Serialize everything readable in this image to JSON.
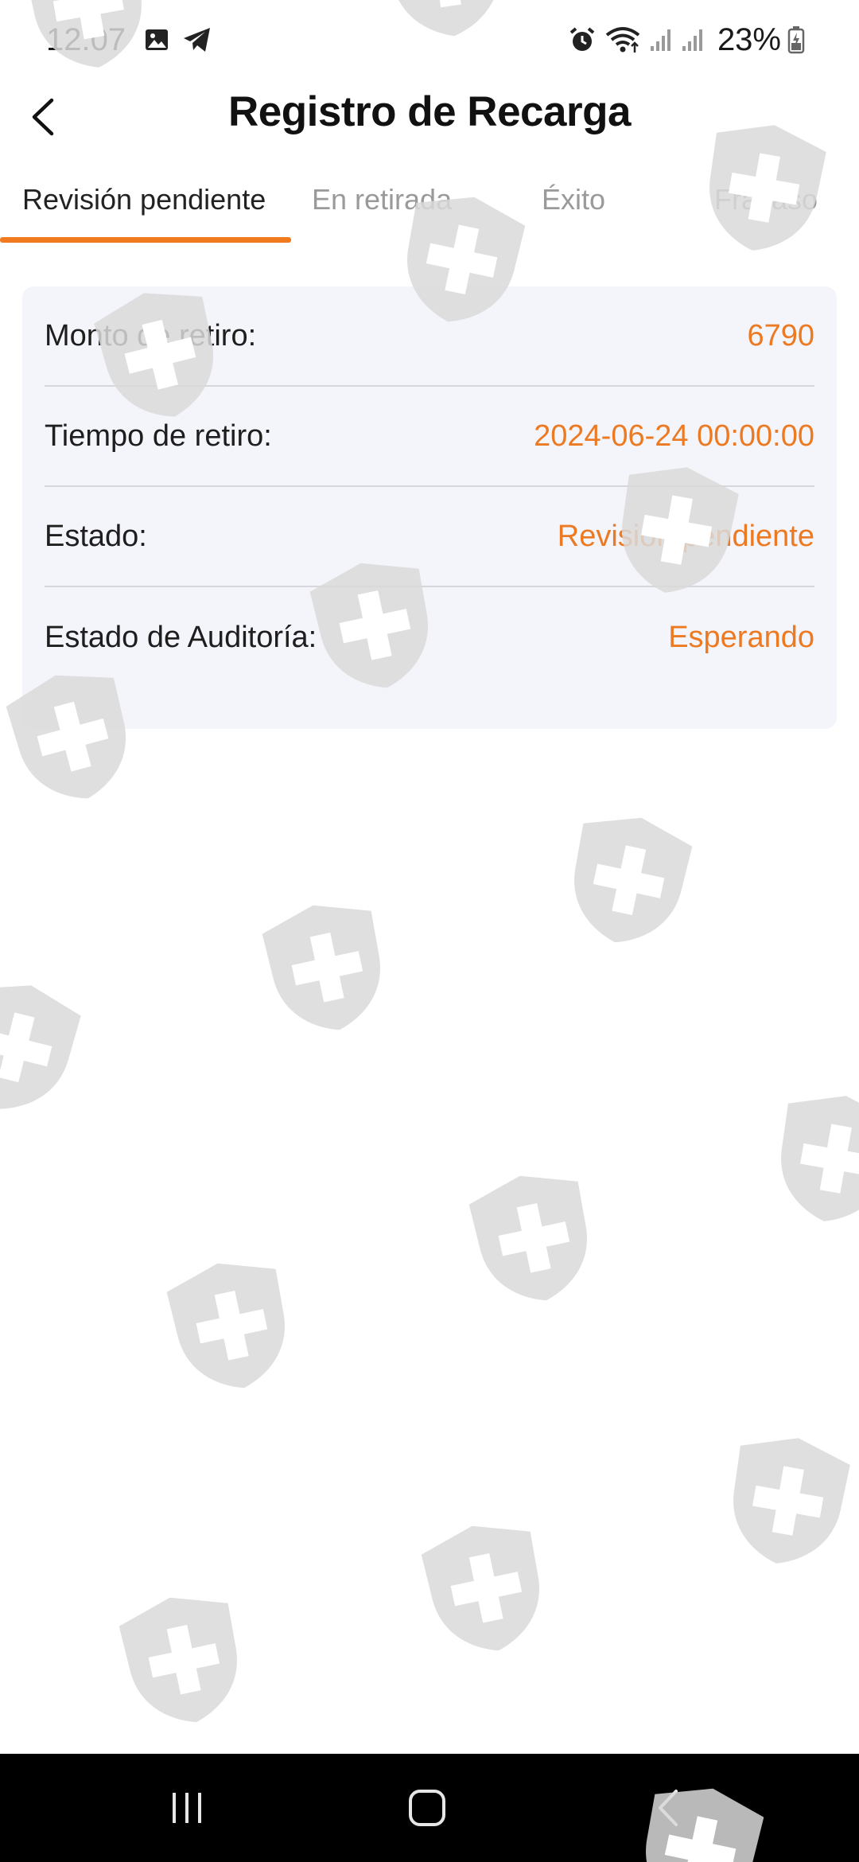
{
  "status_bar": {
    "time": "12:07",
    "battery_percent": "23%",
    "left_icons": [
      "gallery-icon",
      "telegram-icon"
    ],
    "right_icons": [
      "alarm-icon",
      "wifi-icon",
      "signal-icon",
      "signal-icon",
      "battery-icon"
    ]
  },
  "header": {
    "title": "Registro de Recarga",
    "back_icon": "chevron-left-icon"
  },
  "tabs": [
    {
      "label": "Revisión pendiente",
      "active": true
    },
    {
      "label": "En retirada",
      "active": false
    },
    {
      "label": "Éxito",
      "active": false
    },
    {
      "label": "Fracaso",
      "active": false
    }
  ],
  "record": {
    "rows": [
      {
        "label": "Monto de retiro:",
        "value": "6790"
      },
      {
        "label": "Tiempo de retiro:",
        "value": "2024-06-24 00:00:00"
      },
      {
        "label": "Estado:",
        "value": "Revisión pendiente"
      },
      {
        "label": "Estado de Auditoría:",
        "value": "Esperando"
      }
    ]
  },
  "nav_bar": {
    "icons": [
      "recent-apps-icon",
      "home-icon",
      "back-icon"
    ]
  },
  "colors": {
    "accent": "#f07a1d",
    "value_text": "#ec7a22",
    "card_background": "#f4f4fb",
    "watermark": "#d9d9d9"
  },
  "watermark_icon": "shield-plus-icon"
}
